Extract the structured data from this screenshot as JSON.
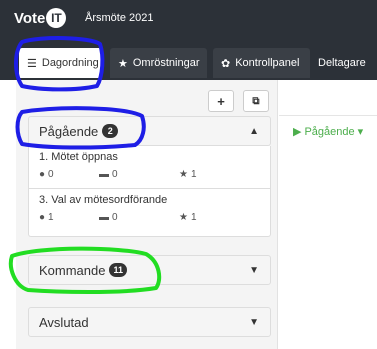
{
  "header": {
    "brand": "Vote",
    "brand_logo": "IT",
    "meeting_title": "Årsmöte 2021"
  },
  "nav": {
    "tabs": [
      {
        "label": "Dagordning",
        "icon": "list-icon",
        "active": true
      },
      {
        "label": "Omröstningar",
        "icon": "star-icon"
      },
      {
        "label": "Kontrollpanel",
        "icon": "gear-icon"
      },
      {
        "label": "Deltagare"
      }
    ]
  },
  "sidebar": {
    "toolbar": {
      "add_icon": "plus-icon",
      "edit_icon": "edit-icon"
    },
    "ongoing": {
      "title": "Pågående",
      "count": "2",
      "items": [
        {
          "title": "1. Mötet öppnas",
          "proposals": "0",
          "comments": "0",
          "polls": "1"
        },
        {
          "title": "3. Val av mötesordförande",
          "proposals": "1",
          "comments": "0",
          "polls": "1"
        }
      ]
    },
    "upcoming": {
      "title": "Kommande",
      "count": "11"
    },
    "closed": {
      "title": "Avslutad"
    }
  },
  "main": {
    "status_filter": "Pågående"
  },
  "colors": {
    "header_bg": "#2c3138",
    "filter_green": "#4cae4c",
    "annotation_blue": "#1e1ee6",
    "annotation_green": "#22dd22"
  }
}
